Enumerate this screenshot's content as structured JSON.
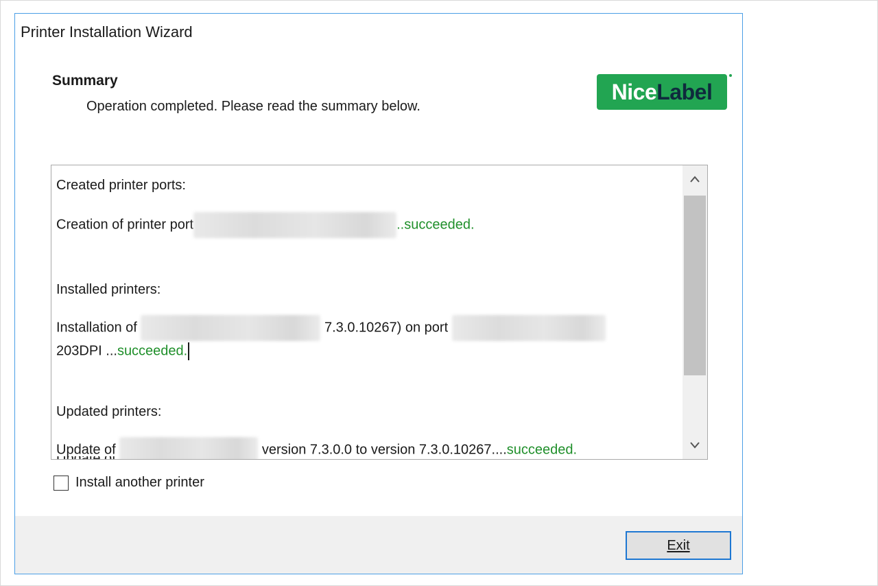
{
  "window": {
    "title": "Printer Installation Wizard"
  },
  "header": {
    "title": "Summary",
    "subtitle": "Operation completed. Please read the summary below."
  },
  "logo": {
    "part1": "Nice",
    "part2": "Label",
    "brand_color": "#22a552"
  },
  "summary": {
    "ports_heading": "Created printer ports:",
    "port_line_prefix": "Creation of printer port",
    "port_line_status": "..succeeded.",
    "installed_heading": "Installed printers:",
    "install_line_prefix": "Installation of",
    "install_line_version": "7.3.0.10267) on port",
    "install_line2_prefix": "203DPI ...",
    "install_line2_status": "succeeded.",
    "updated_heading": "Updated printers:",
    "update_line_prefix": "Update of",
    "update_line_version": "version 7.3.0.0 to version 7.3.0.10267....",
    "update_line_status": "succeeded.",
    "status_color": "#1f8f2a"
  },
  "scrollbar": {
    "up_icon": "▲",
    "down_icon": "▼"
  },
  "checkbox": {
    "label": "Install another printer",
    "checked": false
  },
  "footer": {
    "exit_label": "Exit"
  }
}
